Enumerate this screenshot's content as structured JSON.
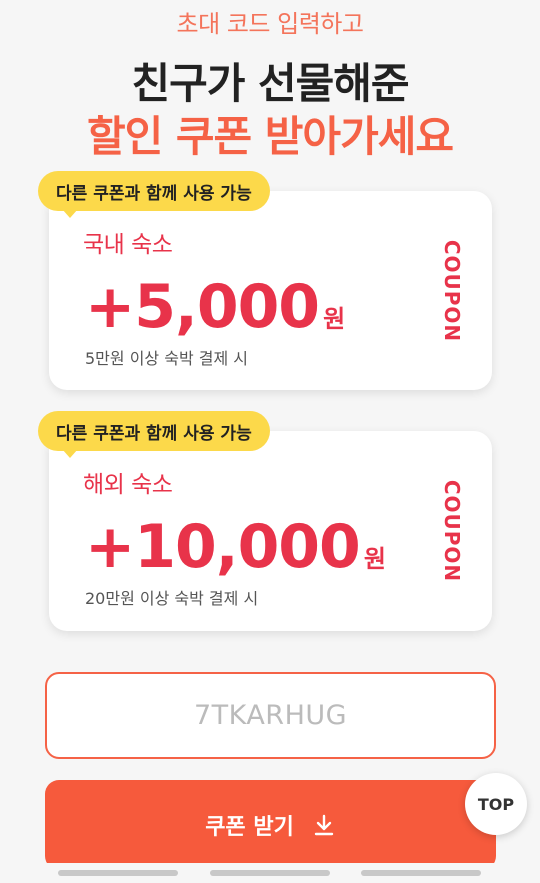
{
  "header": {
    "subtitle": "초대 코드 입력하고",
    "headline_line1": "친구가 선물해준",
    "headline_line2": "할인 쿠폰 받아가세요"
  },
  "coupons": [
    {
      "badge": "다른 쿠폰과 함께 사용 가능",
      "title": "국내 숙소",
      "amount": "+5,000",
      "unit": "원",
      "condition": "5만원 이상 숙박 결제 시",
      "side_label": "COUPON"
    },
    {
      "badge": "다른 쿠폰과 함께 사용 가능",
      "title": "해외 숙소",
      "amount": "+10,000",
      "unit": "원",
      "condition": "20만원 이상 숙박 결제 시",
      "side_label": "COUPON"
    }
  ],
  "code_input": {
    "placeholder": "7TKARHUG"
  },
  "cta": {
    "label": "쿠폰 받기",
    "icon": "download-icon"
  },
  "top_button": {
    "label": "TOP"
  },
  "colors": {
    "accent": "#f65a3c",
    "coupon_red": "#e8334a",
    "badge_yellow": "#fcd94a",
    "background": "#f6f6f6"
  }
}
